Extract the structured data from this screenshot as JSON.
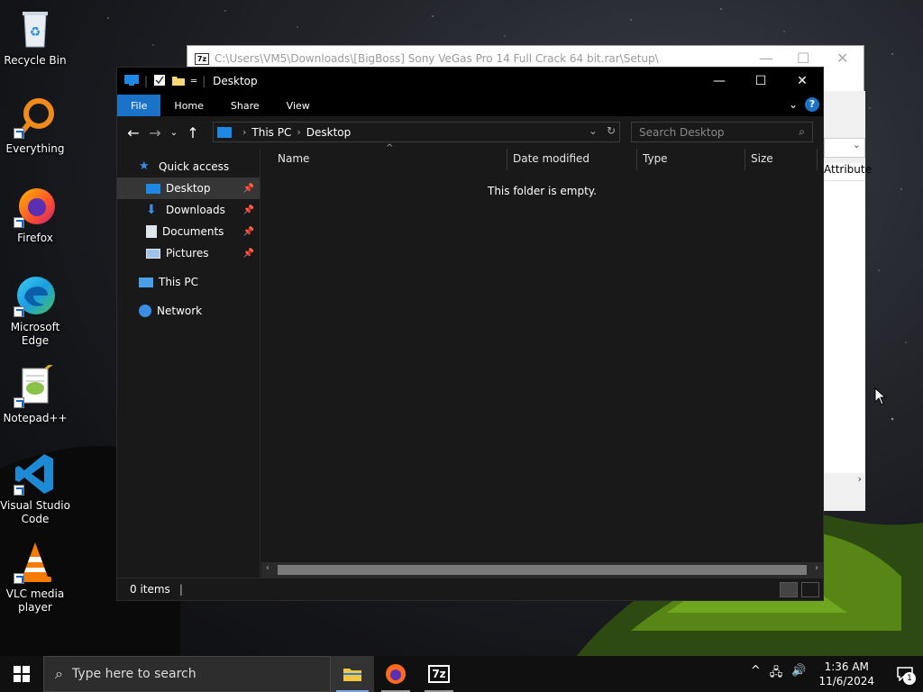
{
  "desktop": {
    "icons": [
      {
        "label": "Recycle Bin",
        "icon": "recycle-bin-icon"
      },
      {
        "label": "Everything",
        "icon": "everything-icon"
      },
      {
        "label": "Firefox",
        "icon": "firefox-icon"
      },
      {
        "label": "Microsoft Edge",
        "icon": "edge-icon"
      },
      {
        "label": "Notepad++",
        "icon": "notepad-plus-plus-icon"
      },
      {
        "label": "Visual Studio Code",
        "icon": "vscode-icon"
      },
      {
        "label": "VLC media player",
        "icon": "vlc-icon"
      }
    ]
  },
  "bg_window": {
    "title": "C:\\Users\\VM5\\Downloads\\[BigBoss] Sony VeGas Pro 14 Full Crack 64 bit.rar\\Setup\\",
    "column_partial": "Attribute",
    "app_icon_text": "7z"
  },
  "explorer": {
    "title": "Desktop",
    "tabs": [
      "File",
      "Home",
      "Share",
      "View"
    ],
    "address": {
      "root": "This PC",
      "current": "Desktop"
    },
    "search_placeholder": "Search Desktop",
    "nav": {
      "quick_access": "Quick access",
      "pinned": [
        "Desktop",
        "Downloads",
        "Documents",
        "Pictures"
      ],
      "this_pc": "This PC",
      "network": "Network"
    },
    "columns": [
      "Name",
      "Date modified",
      "Type",
      "Size"
    ],
    "empty_message": "This folder is empty.",
    "status": "0 items"
  },
  "taskbar": {
    "search_placeholder": "Type here to search",
    "pinned": [
      "file-explorer-icon",
      "firefox-icon",
      "7zip-icon"
    ],
    "clock_time": "1:36 AM",
    "clock_date": "11/6/2024",
    "notification_count": "1"
  },
  "colors": {
    "accent": "#1a73c8",
    "titlebar": "#000000",
    "window_bg": "#191919"
  }
}
